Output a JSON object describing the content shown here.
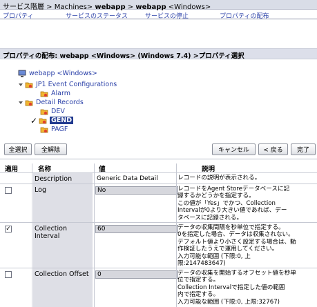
{
  "breadcrumb": {
    "prefix": "サービス階層 > Machines> ",
    "p1": "webapp",
    "sep": " > ",
    "p2": "webapp",
    "suffix": " <Windows>"
  },
  "tabs": [
    "プロパティ",
    "サービスのステータス",
    "サービスの停止",
    "プロパティの配布"
  ],
  "section_title": "プロパティの配布: webapp <Windows> (Windows 7.4) >プロパティ選択",
  "tree": {
    "root": "webapp <Windows>",
    "jp1": "JP1 Event Configurations",
    "alarm": "Alarm",
    "detail": "Detail Records",
    "dev": "DEV",
    "gend": "GEND",
    "pagf": "PAGF"
  },
  "buttons": {
    "select_all": "全選択",
    "clear_all": "全解除",
    "cancel": "キャンセル",
    "back": "< 戻る",
    "finish": "完了"
  },
  "table": {
    "headers": [
      "適用",
      "名称",
      "値",
      "説明"
    ],
    "rows": [
      {
        "name": "Description",
        "value": "Generic Data Detail",
        "checkbox": false,
        "checked": false,
        "desc": [
          "レコードの説明が表示される。"
        ]
      },
      {
        "name": "Log",
        "value": "No",
        "checkbox": true,
        "checked": false,
        "desc": [
          "レコードをAgent Storeデータベースに記",
          "録するかどうかを指定する。",
          "この値が「Yes」でかつ、Collection",
          "Intervalが0より大きい値であれば、デー",
          "タベースに記録される。"
        ]
      },
      {
        "name": "Collection Interval",
        "value": "60",
        "checkbox": true,
        "checked": true,
        "desc": [
          "データの収集間隔を秒単位で指定する。",
          "0を指定した場合、データは収集されない。",
          "デフォルト値より小さく設定する場合は、動",
          "作検証したうえで運用してください。",
          "入力可能な範囲 (下限:0, 上",
          "限:2147483647)"
        ]
      },
      {
        "name": "Collection Offset",
        "value": "0",
        "checkbox": true,
        "checked": false,
        "desc": [
          "データの収集を開始するオフセット値を秒単",
          "位で指定する。",
          "Collection Intervalで指定した値の範囲",
          "内で指定する。",
          "入力可能な範囲 (下限:0, 上限:32767)"
        ]
      }
    ]
  },
  "colors": {
    "accent": "#213a8f",
    "link": "#2b41a8",
    "header_bg": "#dcdfea"
  },
  "icons": [
    "monitor-icon",
    "folder-icon",
    "check-icon"
  ]
}
